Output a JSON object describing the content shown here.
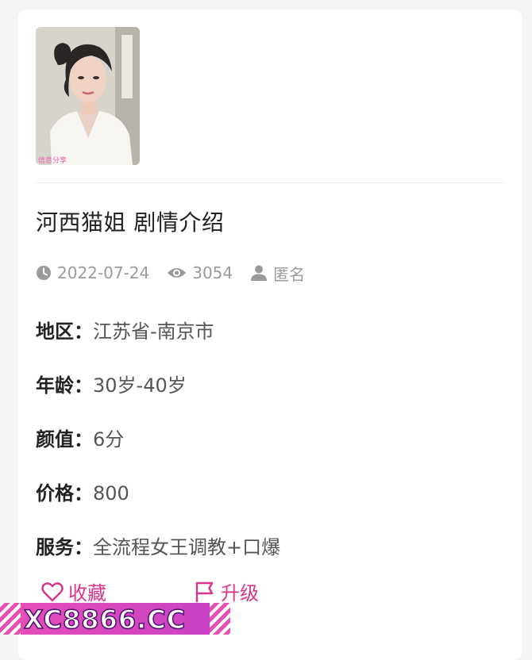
{
  "post": {
    "title": "河西猫姐 剧情介绍",
    "date": "2022-07-24",
    "views": "3054",
    "author": "匿名"
  },
  "fields": [
    {
      "label": "地区：",
      "value": "江苏省-南京市"
    },
    {
      "label": "年龄：",
      "value": "30岁-40岁"
    },
    {
      "label": "颜值：",
      "value": "6分"
    },
    {
      "label": "价格：",
      "value": "800"
    },
    {
      "label": "服务：",
      "value": "全流程女王调教+口爆"
    }
  ],
  "actions": {
    "favorite": "收藏",
    "upgrade": "升级"
  },
  "watermark": {
    "text": "XC8866.CC",
    "photo_mark": "信息分享"
  },
  "icons": {
    "clock": "clock-icon",
    "eye": "eye-icon",
    "user": "user-icon",
    "heart": "heart-icon",
    "flag": "flag-icon"
  },
  "colors": {
    "accent": "#d9368b",
    "meta": "#9a9a9a",
    "banner": "#e84fb5"
  }
}
